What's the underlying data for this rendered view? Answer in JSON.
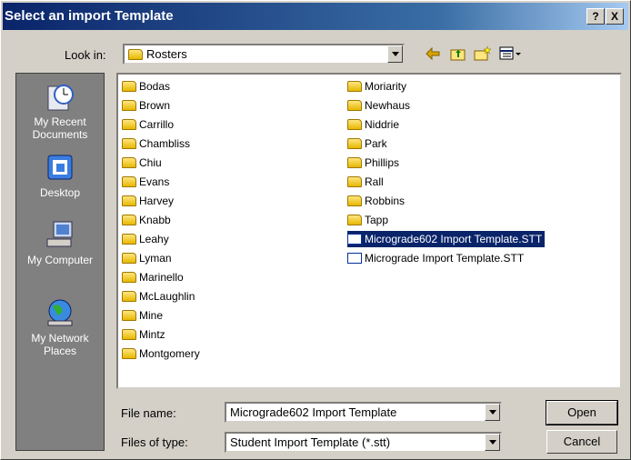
{
  "window": {
    "title": "Select an import Template",
    "help_label": "?",
    "close_label": "X"
  },
  "lookin": {
    "label": "Look in:",
    "value": "Rosters"
  },
  "places": [
    {
      "label": "My Recent Documents",
      "icon": "recent-documents-icon"
    },
    {
      "label": "Desktop",
      "icon": "desktop-icon"
    },
    {
      "label": "My Computer",
      "icon": "my-computer-icon"
    },
    {
      "label": "My Network Places",
      "icon": "network-places-icon"
    }
  ],
  "files_col1": [
    "Bodas",
    "Brown",
    "Carrillo",
    "Chambliss",
    "Chiu",
    "Evans",
    "Harvey",
    "Knabb",
    "Leahy",
    "Lyman",
    "Marinello",
    "McLaughlin",
    "Mine",
    "Mintz",
    "Montgomery"
  ],
  "files_col2": [
    "Moriarity",
    "Newhaus",
    "Niddrie",
    "Park",
    "Phillips",
    "Rall",
    "Robbins",
    "Tapp"
  ],
  "template_files": [
    "Micrograde602 Import Template.STT",
    "Micrograde Import Template.STT"
  ],
  "selected_file": "Micrograde602 Import Template.STT",
  "filename": {
    "label": "File name:",
    "value": "Micrograde602 Import Template"
  },
  "filetype": {
    "label": "Files of type:",
    "value": "Student Import Template (*.stt)"
  },
  "buttons": {
    "open": "Open",
    "cancel": "Cancel"
  },
  "colors": {
    "title_start": "#0a246a",
    "title_end": "#a6caf0",
    "selection": "#0a246a",
    "dialog_bg": "#d4d0c8",
    "places_bg": "#808080"
  }
}
